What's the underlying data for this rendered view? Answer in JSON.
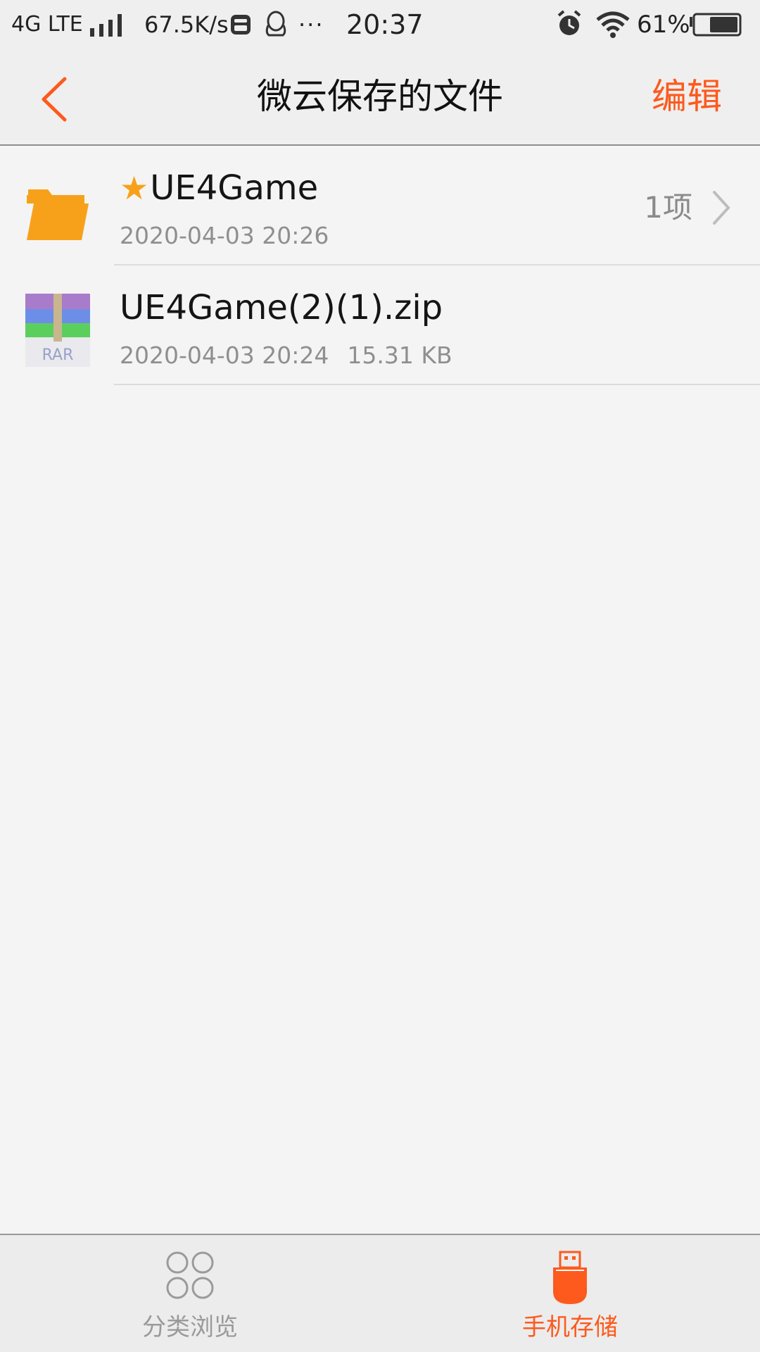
{
  "status_bar": {
    "network": "4G LTE",
    "speed": "67.5K/s",
    "more": "···",
    "time": "20:37",
    "battery_percent": "61%"
  },
  "header": {
    "title": "微云保存的文件",
    "edit_label": "编辑"
  },
  "files": [
    {
      "name": "UE4Game",
      "starred": true,
      "date": "2020-04-03 20:26",
      "count": "1项",
      "type": "folder"
    },
    {
      "name": "UE4Game(2)(1).zip",
      "starred": false,
      "date": "2020-04-03 20:24",
      "size": "15.31 KB",
      "type": "rar-archive",
      "icon_label": "RAR"
    }
  ],
  "tabs": [
    {
      "label": "分类浏览",
      "icon": "category-grid-icon",
      "active": false
    },
    {
      "label": "手机存储",
      "icon": "usb-storage-icon",
      "active": true
    }
  ],
  "colors": {
    "accent": "#ff5a1e",
    "folder": "#f7a11a",
    "background": "#f4f4f4",
    "secondary_text": "#8f8f8f"
  }
}
